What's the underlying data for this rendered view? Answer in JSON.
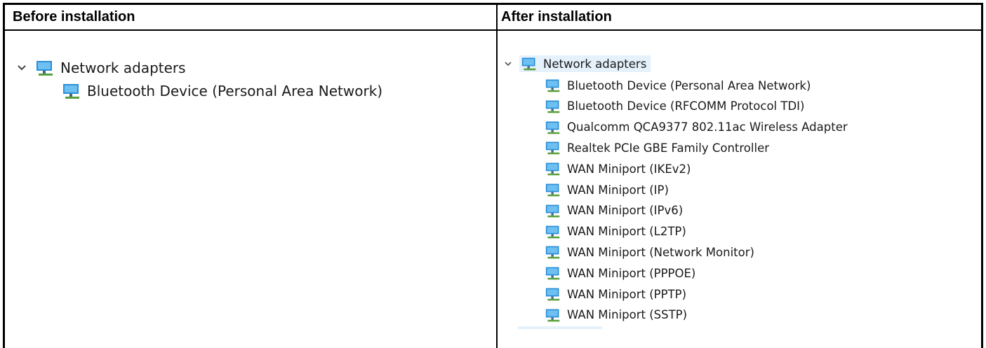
{
  "table": {
    "col_before_header": "Before installation",
    "col_after_header": "After installation"
  },
  "before": {
    "category": "Network adapters",
    "devices": [
      "Bluetooth Device (Personal Area Network)"
    ]
  },
  "after": {
    "category": "Network adapters",
    "devices": [
      "Bluetooth Device (Personal Area Network)",
      "Bluetooth Device (RFCOMM Protocol TDI)",
      "Qualcomm QCA9377 802.11ac Wireless Adapter",
      "Realtek PCIe GBE Family Controller",
      "WAN Miniport (IKEv2)",
      "WAN Miniport (IP)",
      "WAN Miniport (IPv6)",
      "WAN Miniport (L2TP)",
      "WAN Miniport (Network Monitor)",
      "WAN Miniport (PPPOE)",
      "WAN Miniport (PPTP)",
      "WAN Miniport (SSTP)"
    ]
  },
  "icons": {
    "expand": "chevron-down-icon",
    "adapter": "network-adapter-icon"
  },
  "colors": {
    "selection_bg": "#e5f1fb",
    "monitor_blue": "#2b8fd6"
  }
}
